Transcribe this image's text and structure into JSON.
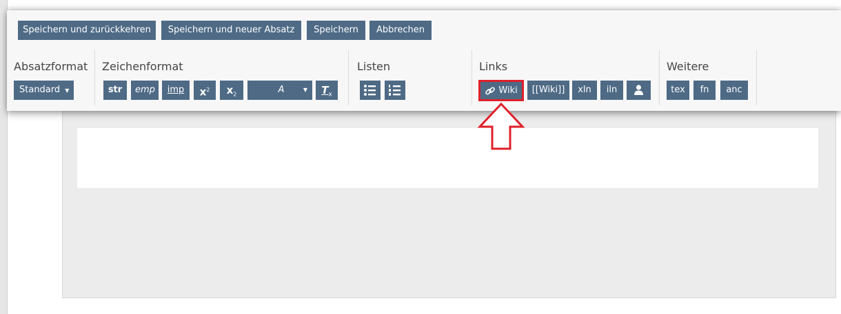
{
  "top_buttons": {
    "save_return": "Speichern und zurückkehren",
    "save_new": "Speichern und neuer Absatz",
    "save": "Speichern",
    "cancel": "Abbrechen"
  },
  "groups": {
    "paragraph": {
      "label": "Absatzformat",
      "dropdown": "Standard"
    },
    "character": {
      "label": "Zeichenformat",
      "str": "str",
      "emp": "emp",
      "imp": "imp",
      "sup_base": "x",
      "sup_exp": "2",
      "sub_base": "x",
      "sub_exp": "2",
      "style_dropdown": "A",
      "clear_base": "T",
      "clear_mark": "x"
    },
    "lists": {
      "label": "Listen"
    },
    "links": {
      "label": "Links",
      "wiki": "Wiki",
      "wiki_brackets": "[[Wiki]]",
      "xln": "xln",
      "iln": "iln"
    },
    "more": {
      "label": "Weitere",
      "tex": "tex",
      "fn": "fn",
      "anc": "anc"
    }
  },
  "colors": {
    "button_bg": "#4e6a85",
    "highlight": "#e0202a"
  },
  "icons": [
    "chevron-down-icon",
    "bullet-list-icon",
    "numbered-list-icon",
    "link-icon",
    "user-icon",
    "arrow-up-icon"
  ]
}
